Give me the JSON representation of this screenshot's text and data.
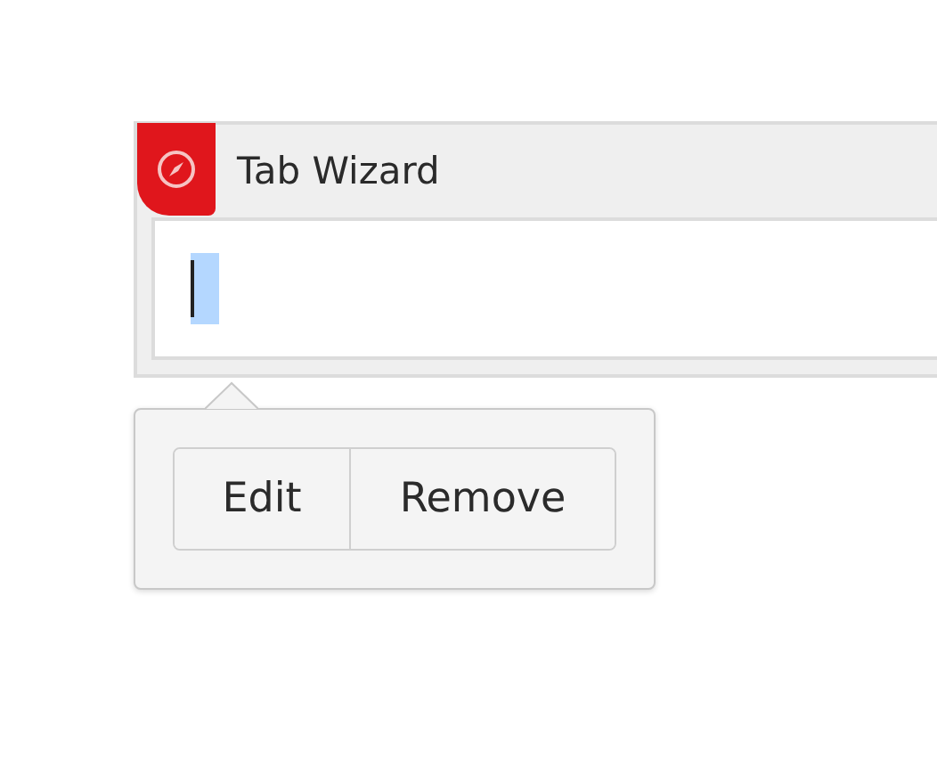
{
  "card": {
    "title": "Tab Wizard"
  },
  "editor": {
    "focused": true
  },
  "popover": {
    "buttons": [
      "Edit",
      "Remove"
    ]
  }
}
